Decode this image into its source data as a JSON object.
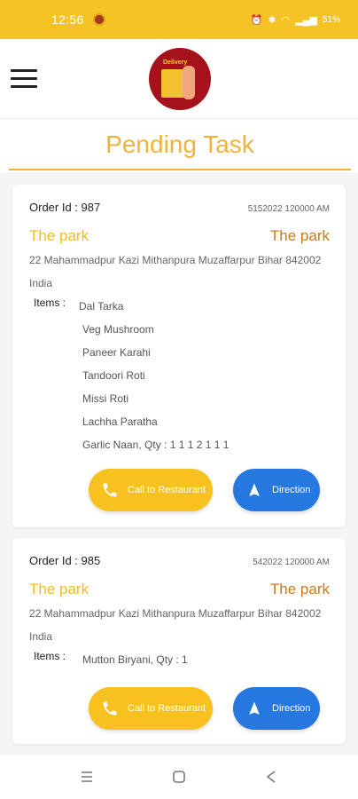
{
  "status": {
    "time": "12:56",
    "battery": "51%"
  },
  "header": {
    "logo_text": "Delivery"
  },
  "page": {
    "title": "Pending Task"
  },
  "orders": [
    {
      "order_id": "Order Id : 987",
      "time": "5152022 120000 AM",
      "restaurant": "The park",
      "restaurant_right": "The park",
      "address": "22 Mahammadpur Kazi Mithanpura Muzaffarpur Bihar 842002 India",
      "items_label": "Items :",
      "items": [
        "Dal Tarka",
        "Veg Mushroom",
        "Paneer Karahi",
        "Tandoori Roti",
        "Missi Roti",
        "Lachha Paratha",
        "Garlic Naan, Qty : 1 1 1 2 1 1 1"
      ],
      "call_label": "Call to Restaurant",
      "direction_label": "Direction"
    },
    {
      "order_id": "Order Id : 985",
      "time": "542022 120000 AM",
      "restaurant": "The park",
      "restaurant_right": "The park",
      "address": "22 Mahammadpur Kazi Mithanpura Muzaffarpur Bihar 842002 India",
      "items_label": "Items :",
      "items": [
        "Mutton Biryani, Qty : 1"
      ],
      "call_label": "Call to Restaurant",
      "direction_label": "Direction"
    }
  ],
  "icons": {
    "menu": "hamburger-icon",
    "phone": "phone-icon",
    "navigation": "navigation-arrow-icon",
    "nav_recent": "recent-apps-icon",
    "nav_home": "home-icon",
    "nav_back": "back-icon"
  },
  "colors": {
    "accent_yellow": "#f6c325",
    "title_orange": "#f0b33b",
    "direction_blue": "#2478e0"
  }
}
